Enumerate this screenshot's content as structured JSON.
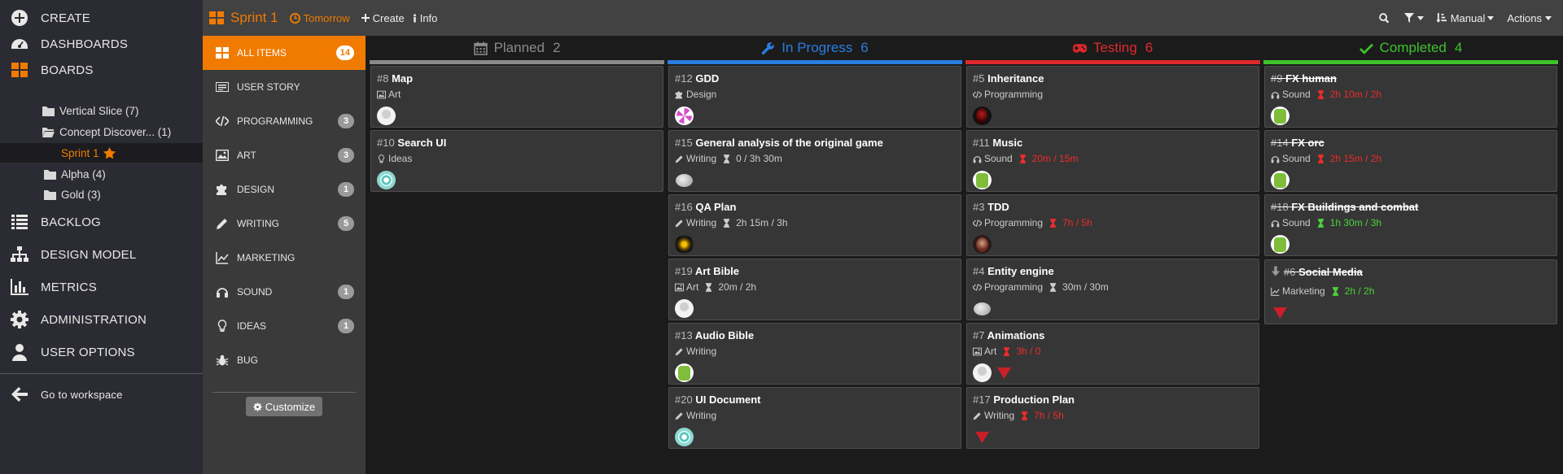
{
  "nav": {
    "items": [
      {
        "label": "CREATE",
        "icon": "plus-circle-icon"
      },
      {
        "label": "DASHBOARDS",
        "icon": "dashboard-icon"
      },
      {
        "label": "BOARDS",
        "icon": "boards-grid-icon"
      },
      {
        "label": "BACKLOG",
        "icon": "list-icon"
      },
      {
        "label": "DESIGN MODEL",
        "icon": "sitemap-icon"
      },
      {
        "label": "METRICS",
        "icon": "bar-chart-icon"
      },
      {
        "label": "ADMINISTRATION",
        "icon": "gear-icon"
      },
      {
        "label": "USER OPTIONS",
        "icon": "user-icon"
      }
    ],
    "tree": [
      {
        "label": "Vertical Slice (7)",
        "icon": "folder-icon"
      },
      {
        "label": "Concept Discover... (1)",
        "icon": "folder-open-icon"
      },
      {
        "label": "Sprint 1",
        "icon": "star-icon"
      },
      {
        "label": "Alpha (4)",
        "icon": "folder-icon"
      },
      {
        "label": "Gold (3)",
        "icon": "folder-icon"
      }
    ],
    "workspace": "Go to workspace",
    "accent": "#f07b00"
  },
  "topbar": {
    "title": "Sprint 1",
    "due": "Tomorrow",
    "create": "Create",
    "info": "Info",
    "sort": "Manual",
    "actions": "Actions"
  },
  "filters": {
    "items": [
      {
        "label": "ALL ITEMS",
        "count": "14",
        "icon": "grid-icon"
      },
      {
        "label": "USER STORY",
        "count": "",
        "icon": "card-icon"
      },
      {
        "label": "PROGRAMMING",
        "count": "3",
        "icon": "code-icon"
      },
      {
        "label": "ART",
        "count": "3",
        "icon": "image-icon"
      },
      {
        "label": "DESIGN",
        "count": "1",
        "icon": "puzzle-icon"
      },
      {
        "label": "WRITING",
        "count": "5",
        "icon": "pencil-icon"
      },
      {
        "label": "MARKETING",
        "count": "",
        "icon": "line-chart-icon"
      },
      {
        "label": "SOUND",
        "count": "1",
        "icon": "headphones-icon"
      },
      {
        "label": "IDEAS",
        "count": "1",
        "icon": "lightbulb-icon"
      },
      {
        "label": "BUG",
        "count": "",
        "icon": "bug-icon"
      }
    ],
    "customize": "Customize"
  },
  "columns": [
    {
      "title": "Planned",
      "count": "2",
      "color": "#8a8a8a",
      "icon": "calendar-icon",
      "cards": [
        {
          "num": "#8",
          "title": "Map",
          "type": "Art",
          "type_icon": "image-icon",
          "est": "",
          "est_color": "",
          "avatars": [
            "blank"
          ],
          "done": false
        },
        {
          "num": "#10",
          "title": "Search UI",
          "type": "Ideas",
          "type_icon": "lightbulb-icon",
          "est": "",
          "est_color": "",
          "avatars": [
            "teal"
          ],
          "done": false
        }
      ]
    },
    {
      "title": "In Progress",
      "count": "6",
      "color": "#2a7de1",
      "icon": "wrench-icon",
      "cards": [
        {
          "num": "#12",
          "title": "GDD",
          "type": "Design",
          "type_icon": "puzzle-icon",
          "est": "",
          "est_color": "",
          "avatars": [
            "pink"
          ],
          "done": false
        },
        {
          "num": "#15",
          "title": "General analysis of the original game",
          "type": "Writing",
          "type_icon": "pencil-icon",
          "est": "0 / 3h 30m",
          "est_color": "#cccccc",
          "avatars": [
            "cloud"
          ],
          "done": false
        },
        {
          "num": "#16",
          "title": "QA Plan",
          "type": "Writing",
          "type_icon": "pencil-icon",
          "est": "2h 15m / 3h",
          "est_color": "#cccccc",
          "avatars": [
            "mask"
          ],
          "done": false
        },
        {
          "num": "#19",
          "title": "Art Bible",
          "type": "Art",
          "type_icon": "image-icon",
          "est": "20m / 2h",
          "est_color": "#cccccc",
          "avatars": [
            "blank"
          ],
          "done": false
        },
        {
          "num": "#13",
          "title": "Audio Bible",
          "type": "Writing",
          "type_icon": "pencil-icon",
          "est": "",
          "est_color": "",
          "avatars": [
            "green"
          ],
          "done": false
        },
        {
          "num": "#20",
          "title": "UI Document",
          "type": "Writing",
          "type_icon": "pencil-icon",
          "est": "",
          "est_color": "",
          "avatars": [
            "teal"
          ],
          "done": false
        }
      ]
    },
    {
      "title": "Testing",
      "count": "6",
      "color": "#e0282c",
      "icon": "gamepad-icon",
      "cards": [
        {
          "num": "#5",
          "title": "Inheritance",
          "type": "Programming",
          "type_icon": "code-icon",
          "est": "",
          "est_color": "",
          "avatars": [
            "dark"
          ],
          "done": false
        },
        {
          "num": "#11",
          "title": "Music",
          "type": "Sound",
          "type_icon": "headphones-icon",
          "est": "20m / 15m",
          "est_color": "#ee2b2b",
          "avatars": [
            "green"
          ],
          "done": false
        },
        {
          "num": "#3",
          "title": "TDD",
          "type": "Programming",
          "type_icon": "code-icon",
          "est": "7h / 5h",
          "est_color": "#ee2b2b",
          "avatars": [
            "face"
          ],
          "done": false
        },
        {
          "num": "#4",
          "title": "Entity engine",
          "type": "Programming",
          "type_icon": "code-icon",
          "est": "30m / 30m",
          "est_color": "#cccccc",
          "avatars": [
            "cloud"
          ],
          "done": false
        },
        {
          "num": "#7",
          "title": "Animations",
          "type": "Art",
          "type_icon": "image-icon",
          "est": "3h / 0",
          "est_color": "#ee2b2b",
          "avatars": [
            "blank",
            "gem"
          ],
          "done": false
        },
        {
          "num": "#17",
          "title": "Production Plan",
          "type": "Writing",
          "type_icon": "pencil-icon",
          "est": "7h / 5h",
          "est_color": "#ee2b2b",
          "avatars": [
            "gem"
          ],
          "done": false
        }
      ]
    },
    {
      "title": "Completed",
      "count": "4",
      "color": "#3ec22e",
      "icon": "check-icon",
      "cards": [
        {
          "num": "#9",
          "title": "FX human",
          "type": "Sound",
          "type_icon": "headphones-icon",
          "est": "2h 10m / 2h",
          "est_color": "#ee2b2b",
          "avatars": [
            "green"
          ],
          "done": true
        },
        {
          "num": "#14",
          "title": "FX orc",
          "type": "Sound",
          "type_icon": "headphones-icon",
          "est": "2h 15m / 2h",
          "est_color": "#ee2b2b",
          "avatars": [
            "green"
          ],
          "done": true
        },
        {
          "num": "#18",
          "title": "FX Buildings and combat",
          "type": "Sound",
          "type_icon": "headphones-icon",
          "est": "1h 30m / 3h",
          "est_color": "#4bd33a",
          "avatars": [
            "green"
          ],
          "done": true
        },
        {
          "num": "#6",
          "title": "Social Media",
          "type": "Marketing",
          "type_icon": "line-chart-icon",
          "est": "2h / 2h",
          "est_color": "#4bd33a",
          "avatars": [
            "gem"
          ],
          "done": true,
          "priority_icon": "arrow-down-icon"
        }
      ]
    }
  ]
}
